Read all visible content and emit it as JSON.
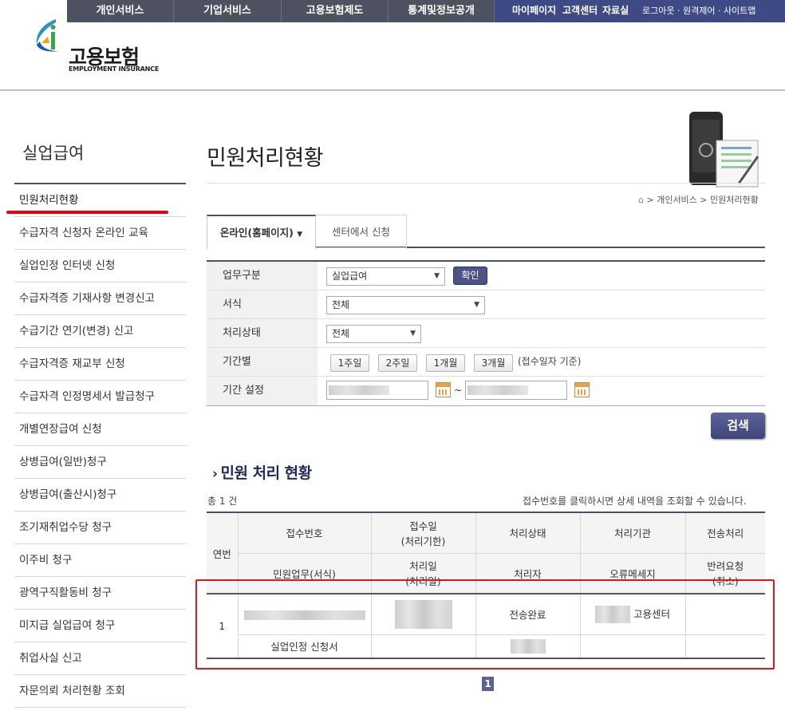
{
  "gnb": {
    "items": [
      "개인서비스",
      "기업서비스",
      "고용보험제도",
      "통계및정보공개"
    ],
    "my_menu": [
      "마이페이지",
      "고객센터",
      "자료실"
    ],
    "util": "로그아웃 · 원격제어 · 사이트맵"
  },
  "logo": {
    "ko": "고용보험",
    "en": "EMPLOYMENT INSURANCE"
  },
  "sidebar": {
    "title": "실업급여",
    "items": [
      "민원처리현황",
      "수급자격 신청자 온라인 교육",
      "실업인정 인터넷 신청",
      "수급자격증 기재사항 변경신고",
      "수급기간 연기(변경) 신고",
      "수급자격증 재교부 신청",
      "수급자격 인정명세서 발급청구",
      "개별연장급여 신청",
      "상병급여(일반)청구",
      "상병급여(출산시)청구",
      "조기재취업수당 청구",
      "이주비 청구",
      "광역구직활동비 청구",
      "미지급 실업급여 청구",
      "취업사실 신고",
      "자문의뢰 처리현황 조회"
    ]
  },
  "page": {
    "title": "민원처리현황",
    "breadcrumb": "> 개인서비스 > 민원처리현황"
  },
  "tabs": {
    "online": "온라인(홈페이지)",
    "center": "센터에서 신청"
  },
  "form": {
    "labels": {
      "work_type": "업무구분",
      "format": "서식",
      "status": "처리상태",
      "period": "기간별",
      "period_set": "기간 설정"
    },
    "work_type_value": "실업급여",
    "confirm_label": "확인",
    "format_value": "전체",
    "status_value": "전체",
    "period_buttons": [
      "1주일",
      "2주일",
      "1개월",
      "3개월"
    ],
    "period_note": "(접수일자 기준)",
    "tilde": "~",
    "search_label": "검색"
  },
  "results": {
    "section_title": "민원 처리 현황",
    "total": "총 1 건",
    "note": "접수번호를 클릭하시면 상세 내역을 조회할 수 있습니다.",
    "headers": {
      "no": "연번",
      "receipt_no": "접수번호",
      "receipt_date": "접수일",
      "receipt_deadline": "(처리기한)",
      "status": "처리상태",
      "agency": "처리기관",
      "transfer": "전송처리",
      "service": "민원업무(서식)",
      "process_date": "처리일",
      "process_date_sub": "(처리일)",
      "processor": "처리자",
      "error_msg": "오류메세지",
      "return_req": "반려요청",
      "return_req_sub": "(취소)"
    },
    "row": {
      "no": "1",
      "status": "전송완료",
      "agency_suffix": "고용센터",
      "service": "실업인정 신청서"
    }
  },
  "pagination": {
    "current": "1"
  }
}
